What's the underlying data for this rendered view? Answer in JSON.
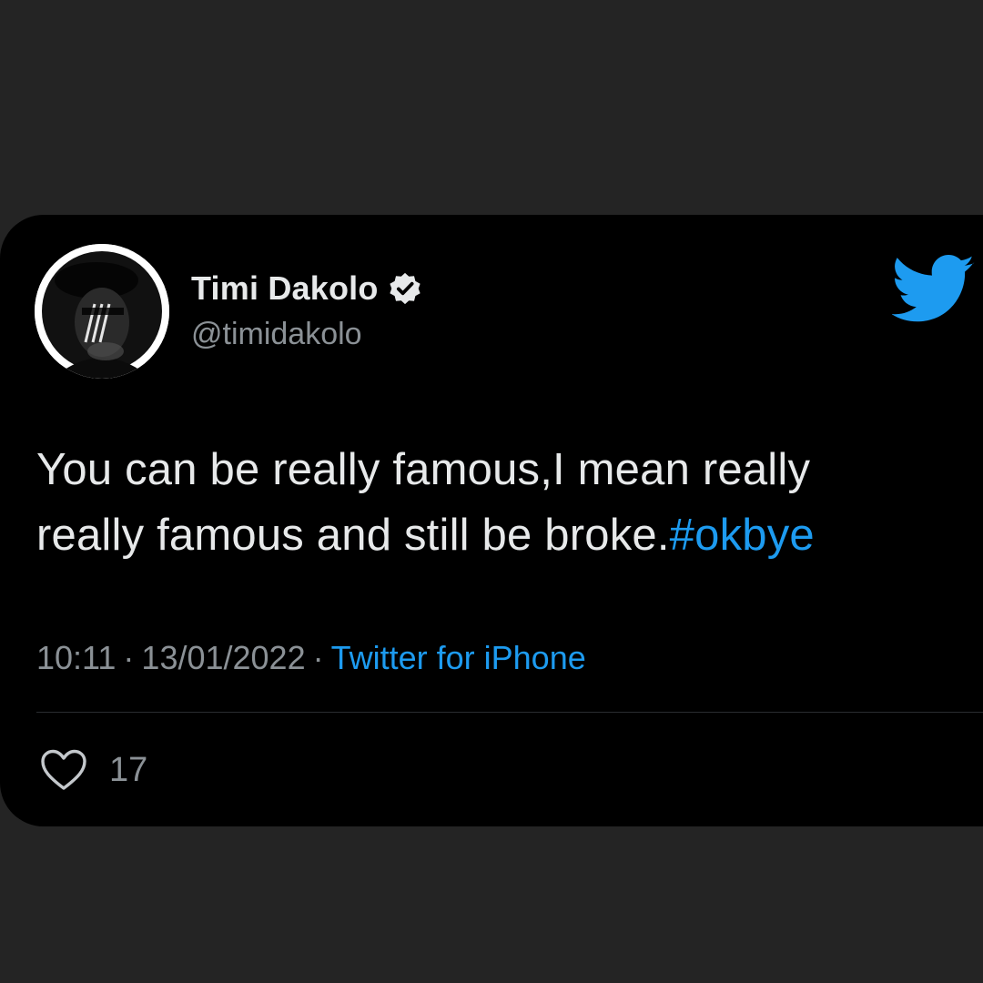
{
  "tweet": {
    "display_name": "Timi Dakolo",
    "handle": "@timidakolo",
    "text_line_1": "You can be really famous,I mean really",
    "text_line_2": "really famous and still be broke.",
    "hashtag": "#okbye",
    "time": "10:11",
    "date": "13/01/2022",
    "separator": "·",
    "source": "Twitter for iPhone",
    "like_count": "17"
  },
  "icons": {
    "verified": "verified-badge-icon",
    "brand": "twitter-bird-icon",
    "like": "heart-outline-icon"
  },
  "colors": {
    "background": "#242424",
    "card": "#000000",
    "accent": "#1d9bf0",
    "text_primary": "#e7e9ea",
    "text_secondary": "#8b9196"
  }
}
